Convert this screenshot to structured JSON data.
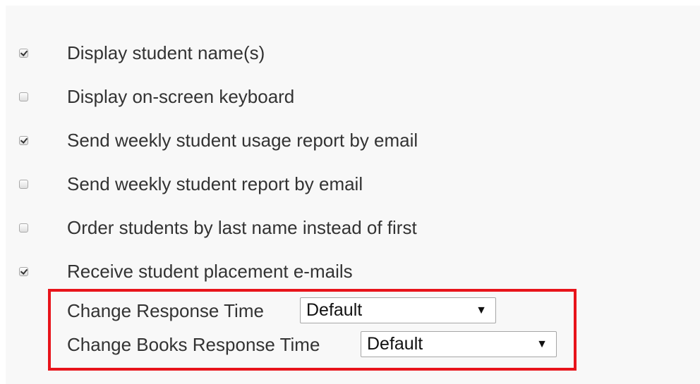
{
  "options": [
    {
      "label": "Display student name(s)",
      "checked": true
    },
    {
      "label": "Display on-screen keyboard",
      "checked": false
    },
    {
      "label": "Send weekly student usage report by email",
      "checked": true
    },
    {
      "label": "Send weekly student report by email",
      "checked": false
    },
    {
      "label": "Order students by last name instead of first",
      "checked": false
    },
    {
      "label": "Receive student placement e-mails",
      "checked": true
    }
  ],
  "response_time": {
    "label": "Change Response Time",
    "selected": "Default"
  },
  "books_response_time": {
    "label": "Change Books Response Time",
    "selected": "Default"
  },
  "icons": {
    "dropdown_arrow": "▼"
  },
  "colors": {
    "highlight": "#e8141b",
    "text": "#333333",
    "panel_background": "#f8f8f8"
  }
}
